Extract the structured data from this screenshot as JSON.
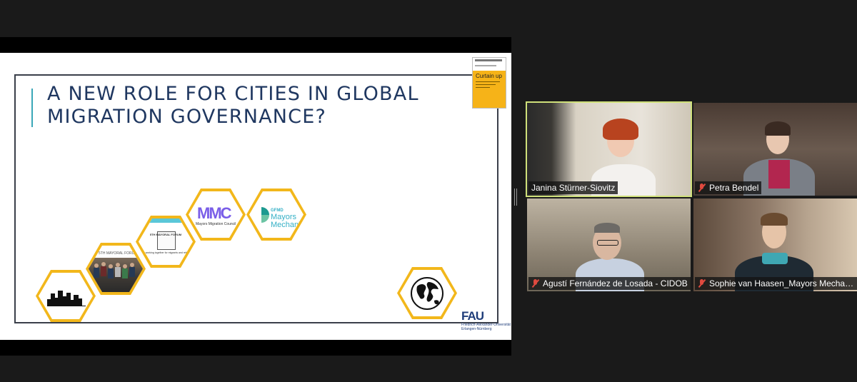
{
  "slide": {
    "title": "A NEW ROLE FOR CITIES IN GLOBAL MIGRATION GOVERNANCE?",
    "book": {
      "title": "Curtain up"
    },
    "hexagons": {
      "forum_label": "5TH MAYORAL FORUM",
      "forum_card_header": "5TH MAYORAL FORUM",
      "forum_card_sub": "Cities working together for migrants and refugees",
      "mmc_logo": "MMC",
      "mmc_caption": "Mayors Migration Council",
      "gfmd_top": "GFMD",
      "gfmd_main_1": "Mayors",
      "gfmd_main_2": "Mechanism"
    },
    "logo": {
      "mark": "FAU",
      "line1": "Friedrich-Alexander-Universität",
      "line2": "Erlangen-Nürnberg"
    }
  },
  "participants": [
    {
      "name": "Janina Stürner-Siovitz",
      "muted": false,
      "active": true
    },
    {
      "name": "Petra Bendel",
      "muted": true,
      "active": false
    },
    {
      "name": "Agustí Fernández de Losada - CIDOB",
      "muted": true,
      "active": false
    },
    {
      "name": "Sophie van Haasen_Mayors Mechanism",
      "muted": true,
      "active": false
    }
  ],
  "colors": {
    "accent_hex": "#f2b71b",
    "title_blue": "#1f3760",
    "active_speaker": "#cfe07a",
    "muted_red": "#e04a3f"
  }
}
